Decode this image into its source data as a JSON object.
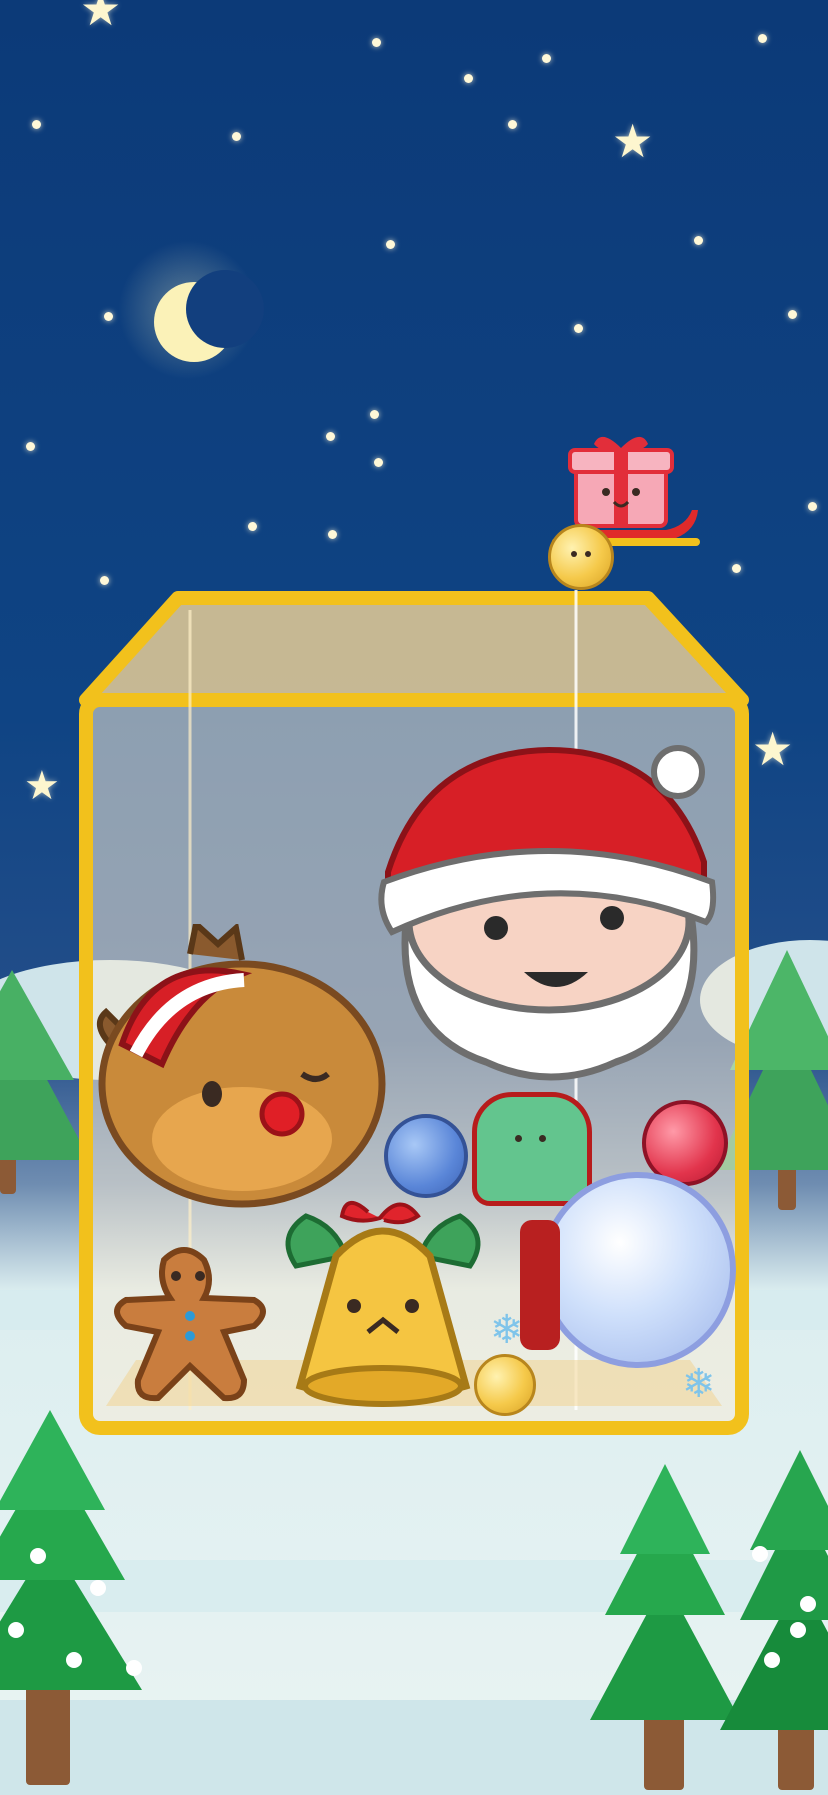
{
  "scene": {
    "title": "",
    "colors": {
      "sky_top": "#0c3a78",
      "container_border": "#f2c11c",
      "santa_red": "#d71f26",
      "tree_green": "#2eb35a",
      "snow": "#e8f4f3"
    }
  },
  "sky": {
    "moon": "crescent-moon",
    "items": [
      "star",
      "dot-star",
      "crescent-moon"
    ]
  },
  "dropper": {
    "vehicle": "santa-sleigh",
    "cargo": "gift-box",
    "current_piece": "gold-ornament-ball"
  },
  "pieces": [
    {
      "name": "santa-head",
      "tier": "largest"
    },
    {
      "name": "reindeer-head",
      "tier": "large"
    },
    {
      "name": "snow-globe",
      "tier": "medium"
    },
    {
      "name": "golden-bell",
      "tier": "medium"
    },
    {
      "name": "gingerbread-man",
      "tier": "small"
    },
    {
      "name": "mitten",
      "tier": "small"
    },
    {
      "name": "blue-ornament",
      "tier": "small"
    },
    {
      "name": "red-ornament",
      "tier": "small"
    },
    {
      "name": "gold-ornament-ball",
      "tier": "smallest"
    },
    {
      "name": "snowflake",
      "tier": "tiny"
    }
  ]
}
